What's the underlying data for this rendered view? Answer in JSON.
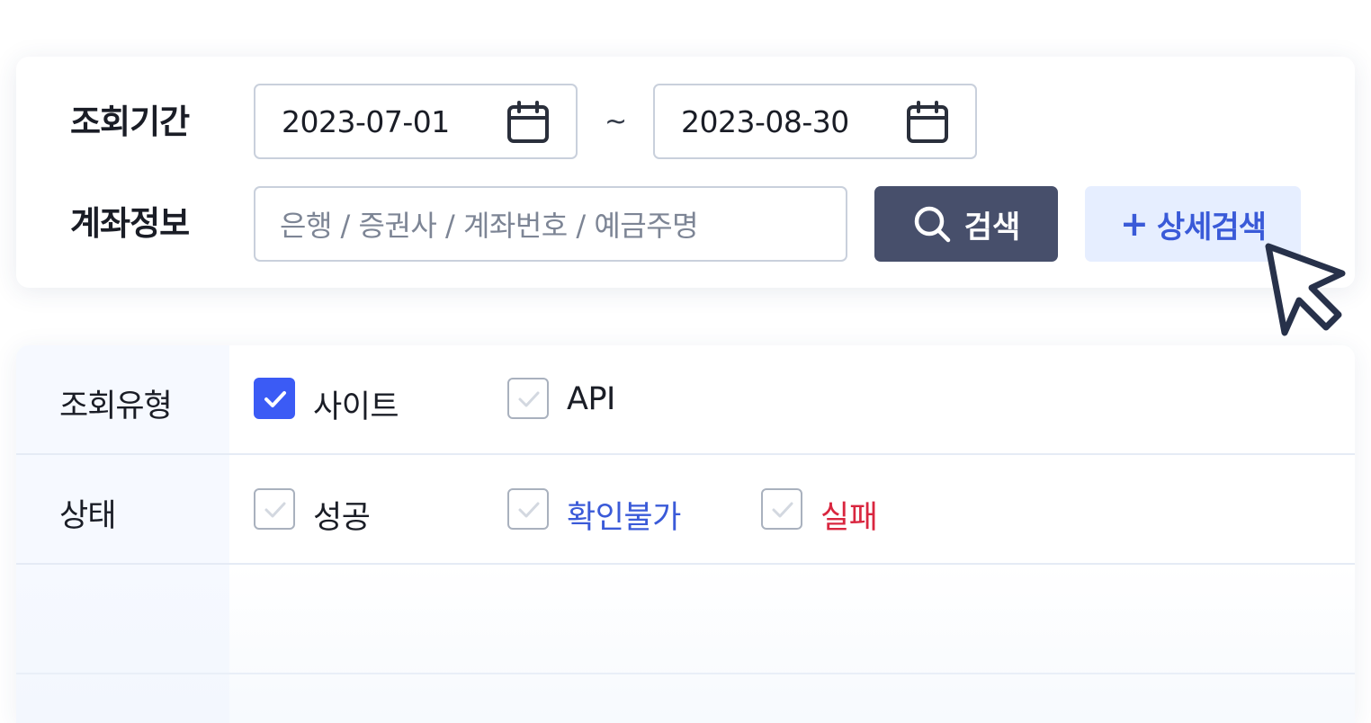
{
  "search": {
    "period_label": "조회기간",
    "start_date": "2023-07-01",
    "end_date": "2023-08-30",
    "range_separator": "~",
    "account_label": "계좌정보",
    "account_placeholder": "은행 / 증권사 / 계좌번호 / 예금주명",
    "search_button": "검색",
    "detail_button_plus": "+",
    "detail_button": "상세검색"
  },
  "filters": {
    "type": {
      "label": "조회유형",
      "options": [
        {
          "label": "사이트",
          "checked": true
        },
        {
          "label": "API",
          "checked": false
        }
      ]
    },
    "status": {
      "label": "상태",
      "options": [
        {
          "label": "성공",
          "checked": false,
          "color": "#1a1d26"
        },
        {
          "label": "확인불가",
          "checked": false,
          "color": "#3a5ad8"
        },
        {
          "label": "실패",
          "checked": false,
          "color": "#d9263f"
        }
      ]
    }
  },
  "colors": {
    "primary_dark": "#474f6b",
    "accent_blue": "#3b5bf5",
    "detail_bg": "#e6eeff",
    "fail_red": "#d9263f"
  },
  "icons": [
    "calendar-icon",
    "search-icon",
    "check-icon",
    "cursor-icon"
  ]
}
